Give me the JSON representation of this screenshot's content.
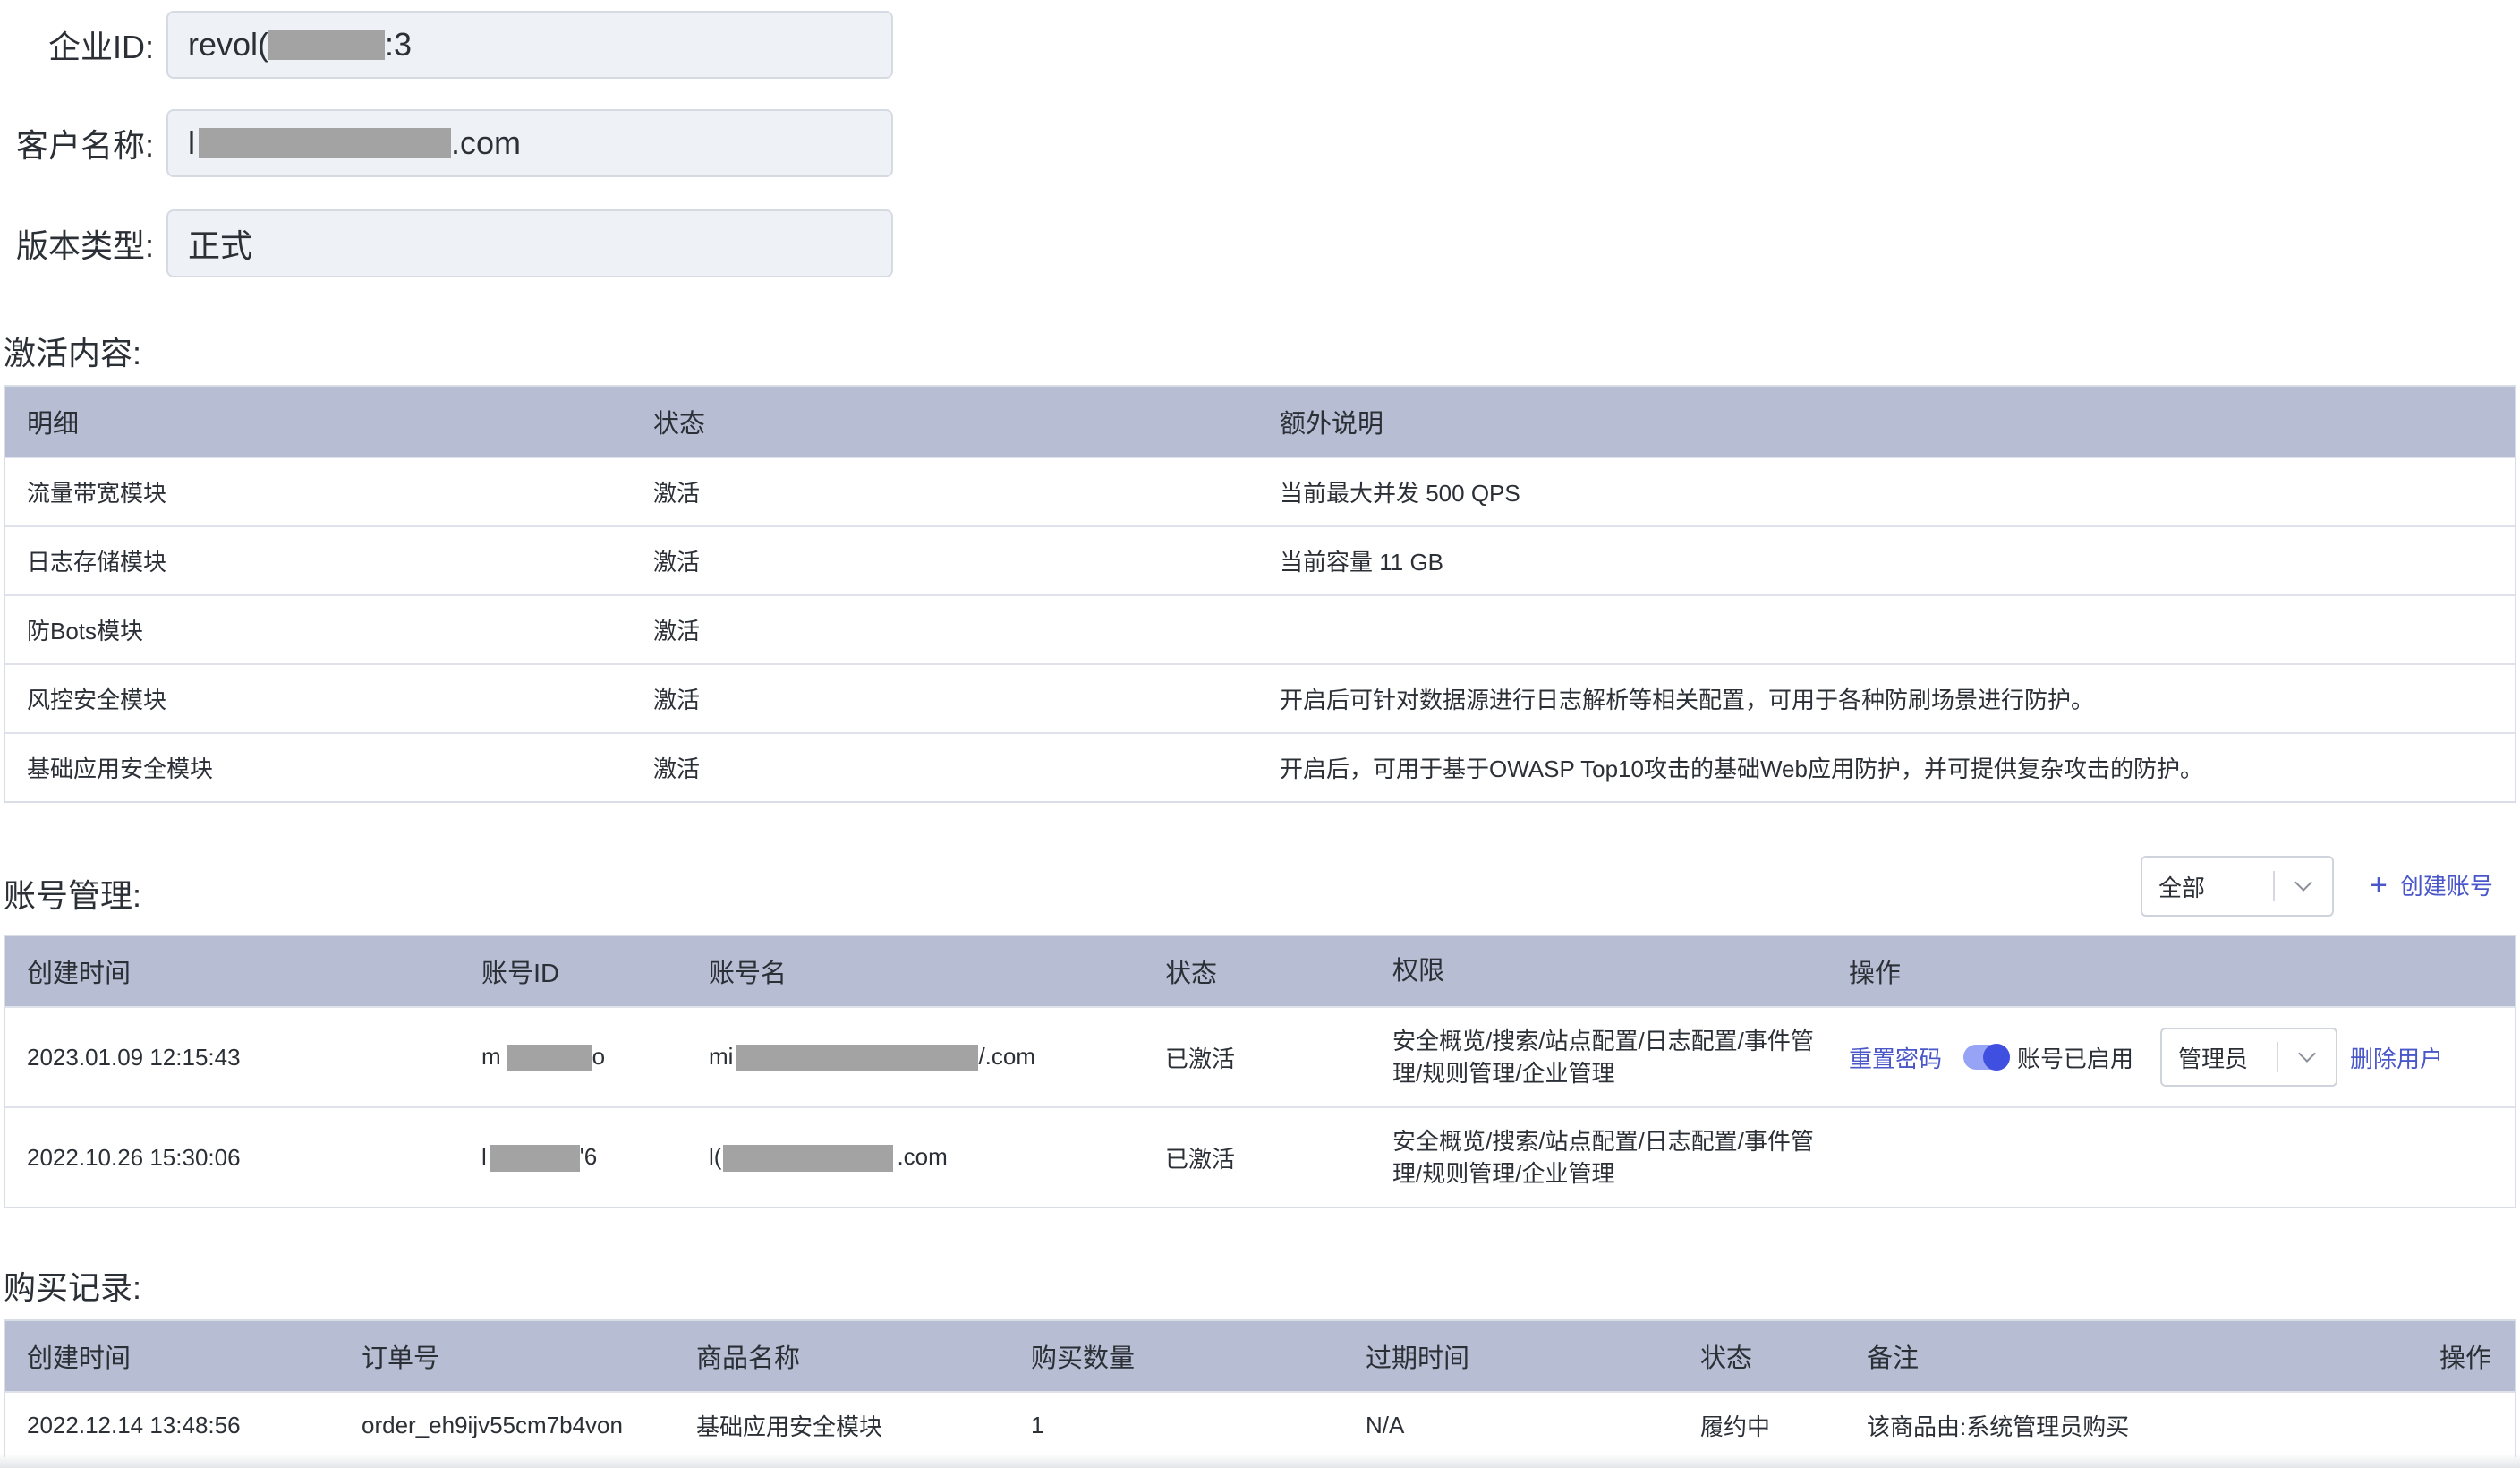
{
  "form": {
    "enterprise_id_label": "企业ID:",
    "enterprise_id_prefix": "revol(",
    "enterprise_id_suffix": ":3",
    "customer_name_label": "客户名称:",
    "customer_name_prefix": "l",
    "customer_name_suffix": ".com",
    "version_label": "版本类型:",
    "version_value": "正式"
  },
  "activation": {
    "title": "激活内容:",
    "headers": [
      "明细",
      "状态",
      "额外说明"
    ],
    "rows": [
      [
        "流量带宽模块",
        "激活",
        "当前最大并发 500 QPS"
      ],
      [
        "日志存储模块",
        "激活",
        "当前容量 11 GB"
      ],
      [
        "防Bots模块",
        "激活",
        ""
      ],
      [
        "风控安全模块",
        "激活",
        "开启后可针对数据源进行日志解析等相关配置，可用于各种防刷场景进行防护。"
      ],
      [
        "基础应用安全模块",
        "激活",
        "开启后，可用于基于OWASP Top10攻击的基础Web应用防护，并可提供复杂攻击的防护。"
      ]
    ]
  },
  "accounts": {
    "title": "账号管理:",
    "filter_value": "全部",
    "create_label": "创建账号",
    "headers": [
      "创建时间",
      "账号ID",
      "账号名",
      "状态",
      "权限",
      "操作"
    ],
    "rows": [
      {
        "created": "2023.01.09 12:15:43",
        "id_prefix": "m",
        "id_suffix": "o",
        "name_prefix": "mi",
        "name_suffix": "/.com",
        "status": "已激活",
        "permissions": "安全概览/搜索/站点配置/日志配置/事件管理/规则管理/企业管理",
        "reset_label": "重置密码",
        "toggle_label": "账号已启用",
        "role_value": "管理员",
        "delete_label": "删除用户"
      },
      {
        "created": "2022.10.26 15:30:06",
        "id_prefix": "l",
        "id_suffix": "'6",
        "name_prefix": "l(",
        "name_suffix": ".com",
        "status": "已激活",
        "permissions": "安全概览/搜索/站点配置/日志配置/事件管理/规则管理/企业管理"
      }
    ]
  },
  "purchases": {
    "title": "购买记录:",
    "headers": [
      "创建时间",
      "订单号",
      "商品名称",
      "购买数量",
      "过期时间",
      "状态",
      "备注",
      "操作"
    ],
    "rows": [
      [
        "2022.12.14 13:48:56",
        "order_eh9ijv55cm7b4von",
        "基础应用安全模块",
        "1",
        "N/A",
        "履约中",
        "该商品由:系统管理员购买",
        ""
      ]
    ]
  },
  "colors": {
    "table_header_bg": "#b7bdd2",
    "link": "#4a57c9",
    "toggle_on": "#3f4fe0",
    "redaction": "#a3a3a3"
  }
}
